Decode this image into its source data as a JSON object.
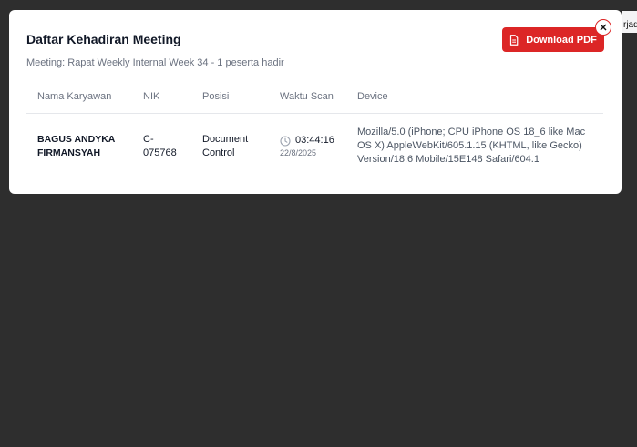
{
  "background": {
    "peek_text": "rjad"
  },
  "modal": {
    "title": "Daftar Kehadiran Meeting",
    "subtitle": "Meeting: Rapat Weekly Internal Week 34 - 1 peserta hadir",
    "download_label": "Download PDF",
    "download_icon": "document-icon",
    "close_icon": "close-icon",
    "accent_color": "#dc2626"
  },
  "table": {
    "headers": {
      "name": "Nama Karyawan",
      "nik": "NIK",
      "position": "Posisi",
      "scan_time": "Waktu Scan",
      "device": "Device"
    },
    "rows": [
      {
        "name": "BAGUS ANDYKA FIRMANSYAH",
        "nik": "C-075768",
        "position": "Document Control",
        "time": "03:44:16",
        "date": "22/8/2025",
        "device": "Mozilla/5.0 (iPhone; CPU iPhone OS 18_6 like Mac OS X) AppleWebKit/605.1.15 (KHTML, like Gecko) Version/18.6 Mobile/15E148 Safari/604.1"
      }
    ]
  }
}
